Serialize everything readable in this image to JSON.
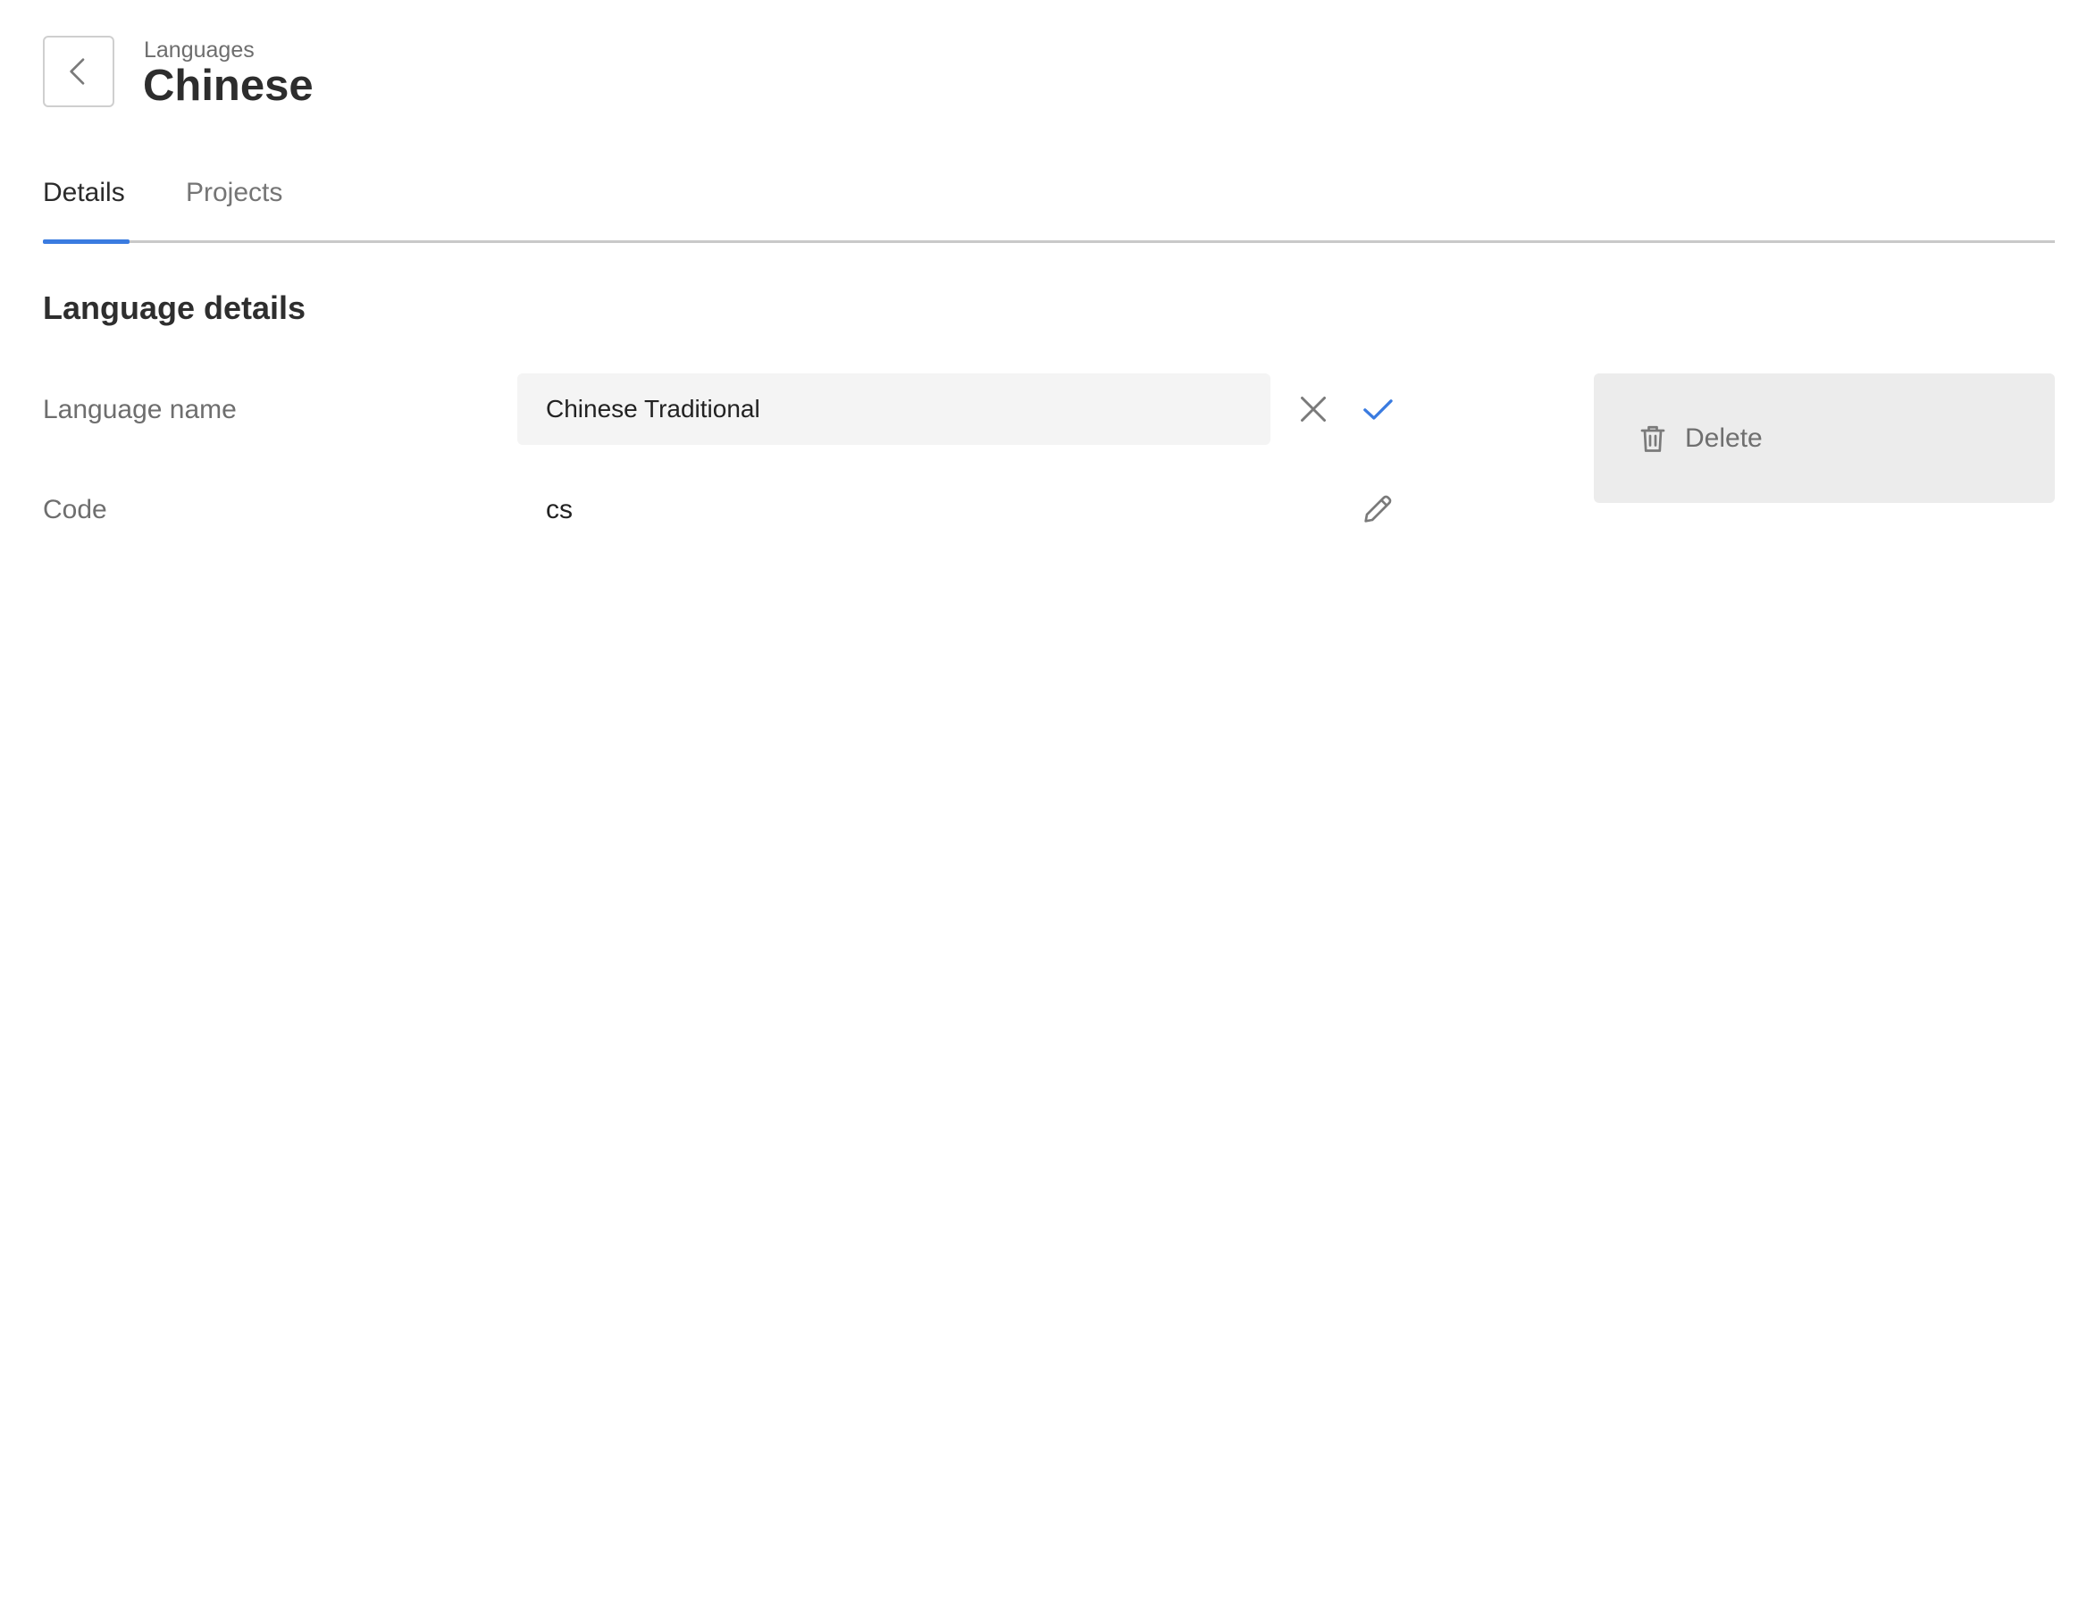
{
  "header": {
    "breadcrumb": "Languages",
    "title": "Chinese"
  },
  "tabs": [
    {
      "label": "Details",
      "active": true
    },
    {
      "label": "Projects",
      "active": false
    }
  ],
  "section": {
    "title": "Language details"
  },
  "fields": {
    "name": {
      "label": "Language name",
      "value": "Chinese Traditional"
    },
    "code": {
      "label": "Code",
      "value": "cs"
    }
  },
  "actions": {
    "delete_label": "Delete"
  },
  "icons": {
    "back": "chevron-left-icon",
    "cancel": "close-icon",
    "confirm": "check-icon",
    "edit": "pencil-icon",
    "delete": "trash-icon"
  },
  "colors": {
    "accent": "#3a7be0",
    "icon_gray": "#7a7a7a",
    "input_bg": "#f4f4f4",
    "delete_bg": "#ececec"
  }
}
